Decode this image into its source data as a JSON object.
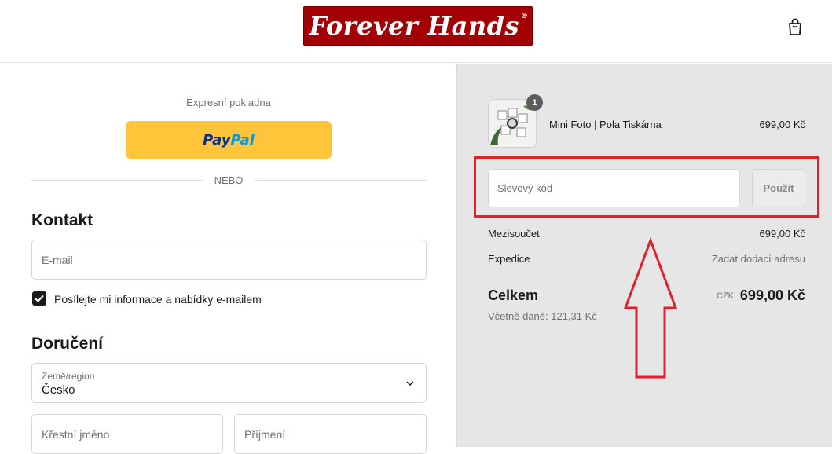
{
  "header": {
    "logo_text": "Forever Hands",
    "logo_mark": "®",
    "cart_icon": "shopping-bag-icon",
    "brand_color": "#a30006"
  },
  "express": {
    "label": "Expresní pokladna",
    "paypal_part1": "Pay",
    "paypal_part2": "Pal",
    "divider": "NEBO"
  },
  "contact": {
    "title": "Kontakt",
    "email_placeholder": "E-mail",
    "newsletter_label": "Posílejte mi informace a nabídky e-mailem",
    "newsletter_checked": true
  },
  "delivery": {
    "title": "Doručení",
    "country_label": "Země/region",
    "country_value": "Česko",
    "first_name_placeholder": "Křestní jméno",
    "last_name_placeholder": "Příjmení"
  },
  "summary": {
    "item": {
      "name": "Mini Foto | Pola Tiskárna",
      "price": "699,00 Kč",
      "quantity": "1"
    },
    "discount_placeholder": "Slevový kód",
    "apply_label": "Použít",
    "subtotal_label": "Mezisoučet",
    "subtotal_value": "699,00 Kč",
    "shipping_label": "Expedice",
    "shipping_value": "Zadat dodací adresu",
    "total_label": "Celkem",
    "total_currency": "CZK",
    "total_value": "699,00 Kč",
    "tax_note": "Včetně daně: 121,31 Kč"
  },
  "annotation": {
    "color": "#e0202a"
  }
}
